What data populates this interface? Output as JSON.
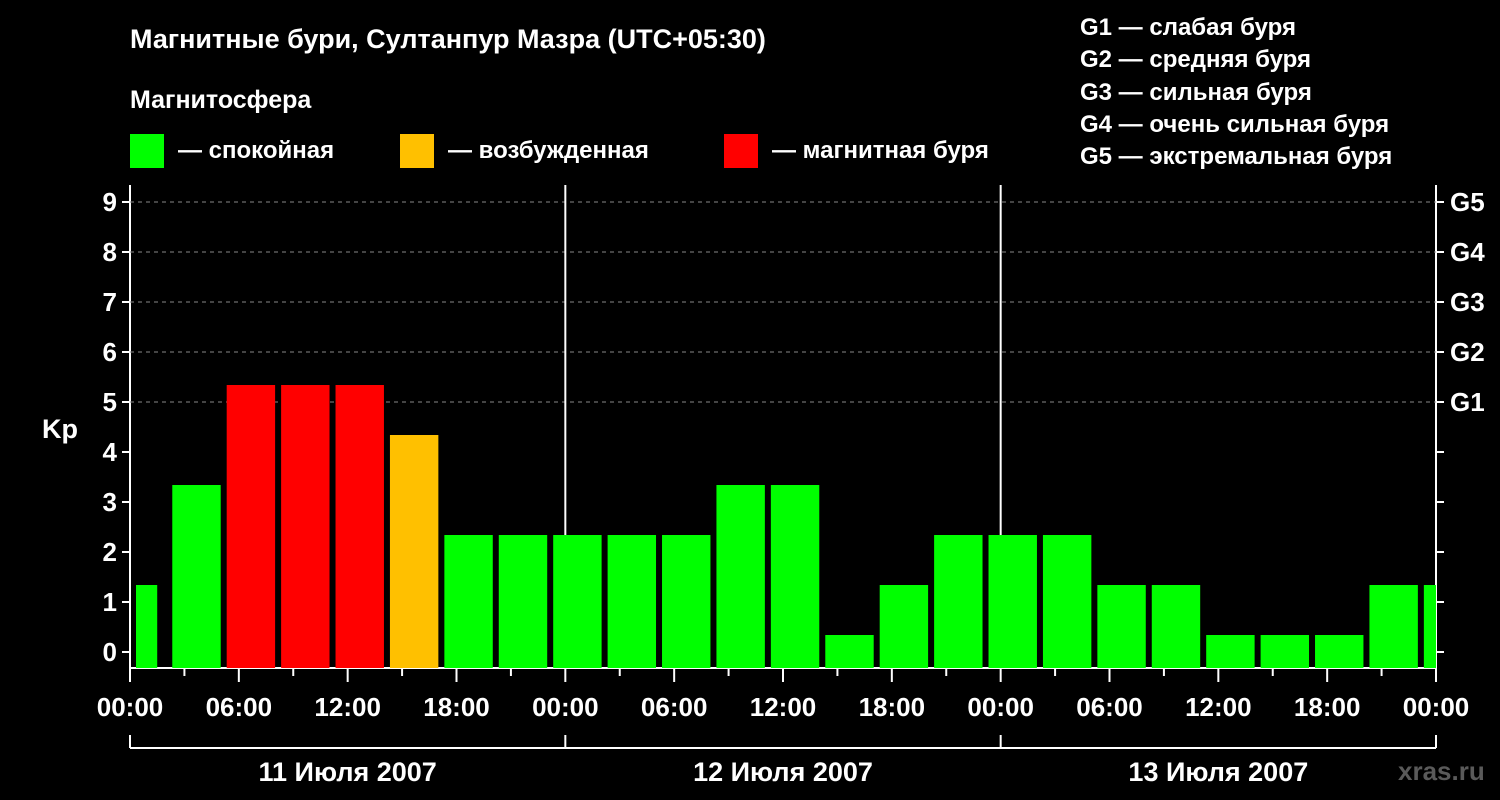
{
  "header": {
    "title": "Магнитные бури, Султанпур Мазра (UTC+05:30)",
    "magnetosphere_label": "Магнитосфера"
  },
  "legend": {
    "calm": {
      "label": "— спокойная",
      "color": "#00ff00"
    },
    "excited": {
      "label": "— возбужденная",
      "color": "#ffc000"
    },
    "storm": {
      "label": "— магнитная буря",
      "color": "#ff0000"
    }
  },
  "storm_levels": [
    "G1 — слабая буря",
    "G2 — средняя буря",
    "G3 — сильная буря",
    "G4 — очень сильная буря",
    "G5 — экстремальная буря"
  ],
  "watermark": "xras.ru",
  "chart_data": {
    "type": "bar",
    "ylabel": "Kp",
    "ylim": [
      0,
      9
    ],
    "y_ticks": [
      0,
      1,
      2,
      3,
      4,
      5,
      6,
      7,
      8,
      9
    ],
    "right_axis": [
      {
        "kp": 5,
        "label": "G1"
      },
      {
        "kp": 6,
        "label": "G2"
      },
      {
        "kp": 7,
        "label": "G3"
      },
      {
        "kp": 8,
        "label": "G4"
      },
      {
        "kp": 9,
        "label": "G5"
      }
    ],
    "grid": "horizontal dashed at Kp 5–9",
    "x_range_hours": [
      0,
      72
    ],
    "x_tick_labels": [
      "00:00",
      "06:00",
      "12:00",
      "18:00",
      "00:00",
      "06:00",
      "12:00",
      "18:00",
      "00:00",
      "06:00",
      "12:00",
      "18:00",
      "00:00"
    ],
    "days": [
      "11 Июля 2007",
      "12 Июля 2007",
      "13 Июля 2007"
    ],
    "bars": [
      {
        "start": "11 Июля 2007 00:00",
        "end": "11 Июля 2007 01:30",
        "kp": 1,
        "color": "#00ff00"
      },
      {
        "start": "11 Июля 2007 02:00",
        "end": "11 Июля 2007 05:00",
        "kp": 3,
        "color": "#00ff00"
      },
      {
        "start": "11 Июля 2007 05:00",
        "end": "11 Июля 2007 08:00",
        "kp": 5,
        "color": "#ff0000"
      },
      {
        "start": "11 Июля 2007 08:00",
        "end": "11 Июля 2007 11:00",
        "kp": 5,
        "color": "#ff0000"
      },
      {
        "start": "11 Июля 2007 11:00",
        "end": "11 Июля 2007 14:00",
        "kp": 5,
        "color": "#ff0000"
      },
      {
        "start": "11 Июля 2007 14:00",
        "end": "11 Июля 2007 17:00",
        "kp": 4,
        "color": "#ffc000"
      },
      {
        "start": "11 Июля 2007 17:00",
        "end": "11 Июля 2007 20:00",
        "kp": 2,
        "color": "#00ff00"
      },
      {
        "start": "11 Июля 2007 20:00",
        "end": "11 Июля 2007 23:00",
        "kp": 2,
        "color": "#00ff00"
      },
      {
        "start": "11 Июля 2007 23:00",
        "end": "12 Июля 2007 02:00",
        "kp": 2,
        "color": "#00ff00"
      },
      {
        "start": "12 Июля 2007 02:00",
        "end": "12 Июля 2007 05:00",
        "kp": 2,
        "color": "#00ff00"
      },
      {
        "start": "12 Июля 2007 05:00",
        "end": "12 Июля 2007 08:00",
        "kp": 2,
        "color": "#00ff00"
      },
      {
        "start": "12 Июля 2007 08:00",
        "end": "12 Июля 2007 11:00",
        "kp": 3,
        "color": "#00ff00"
      },
      {
        "start": "12 Июля 2007 11:00",
        "end": "12 Июля 2007 14:00",
        "kp": 3,
        "color": "#00ff00"
      },
      {
        "start": "12 Июля 2007 14:00",
        "end": "12 Июля 2007 17:00",
        "kp": 0,
        "color": "#00ff00"
      },
      {
        "start": "12 Июля 2007 17:00",
        "end": "12 Июля 2007 20:00",
        "kp": 1,
        "color": "#00ff00"
      },
      {
        "start": "12 Июля 2007 20:00",
        "end": "12 Июля 2007 23:00",
        "kp": 2,
        "color": "#00ff00"
      },
      {
        "start": "12 Июля 2007 23:00",
        "end": "13 Июля 2007 02:00",
        "kp": 2,
        "color": "#00ff00"
      },
      {
        "start": "13 Июля 2007 02:00",
        "end": "13 Июля 2007 05:00",
        "kp": 2,
        "color": "#00ff00"
      },
      {
        "start": "13 Июля 2007 05:00",
        "end": "13 Июля 2007 08:00",
        "kp": 1,
        "color": "#00ff00"
      },
      {
        "start": "13 Июля 2007 08:00",
        "end": "13 Июля 2007 11:00",
        "kp": 1,
        "color": "#00ff00"
      },
      {
        "start": "13 Июля 2007 11:00",
        "end": "13 Июля 2007 14:00",
        "kp": 0,
        "color": "#00ff00"
      },
      {
        "start": "13 Июля 2007 14:00",
        "end": "13 Июля 2007 17:00",
        "kp": 0,
        "color": "#00ff00"
      },
      {
        "start": "13 Июля 2007 17:00",
        "end": "13 Июля 2007 20:00",
        "kp": 0,
        "color": "#00ff00"
      },
      {
        "start": "13 Июля 2007 20:00",
        "end": "13 Июля 2007 23:00",
        "kp": 1,
        "color": "#00ff00"
      },
      {
        "start": "13 Июля 2007 23:00",
        "end": "14 Июля 2007 00:00",
        "kp": 1,
        "color": "#00ff00"
      }
    ]
  }
}
